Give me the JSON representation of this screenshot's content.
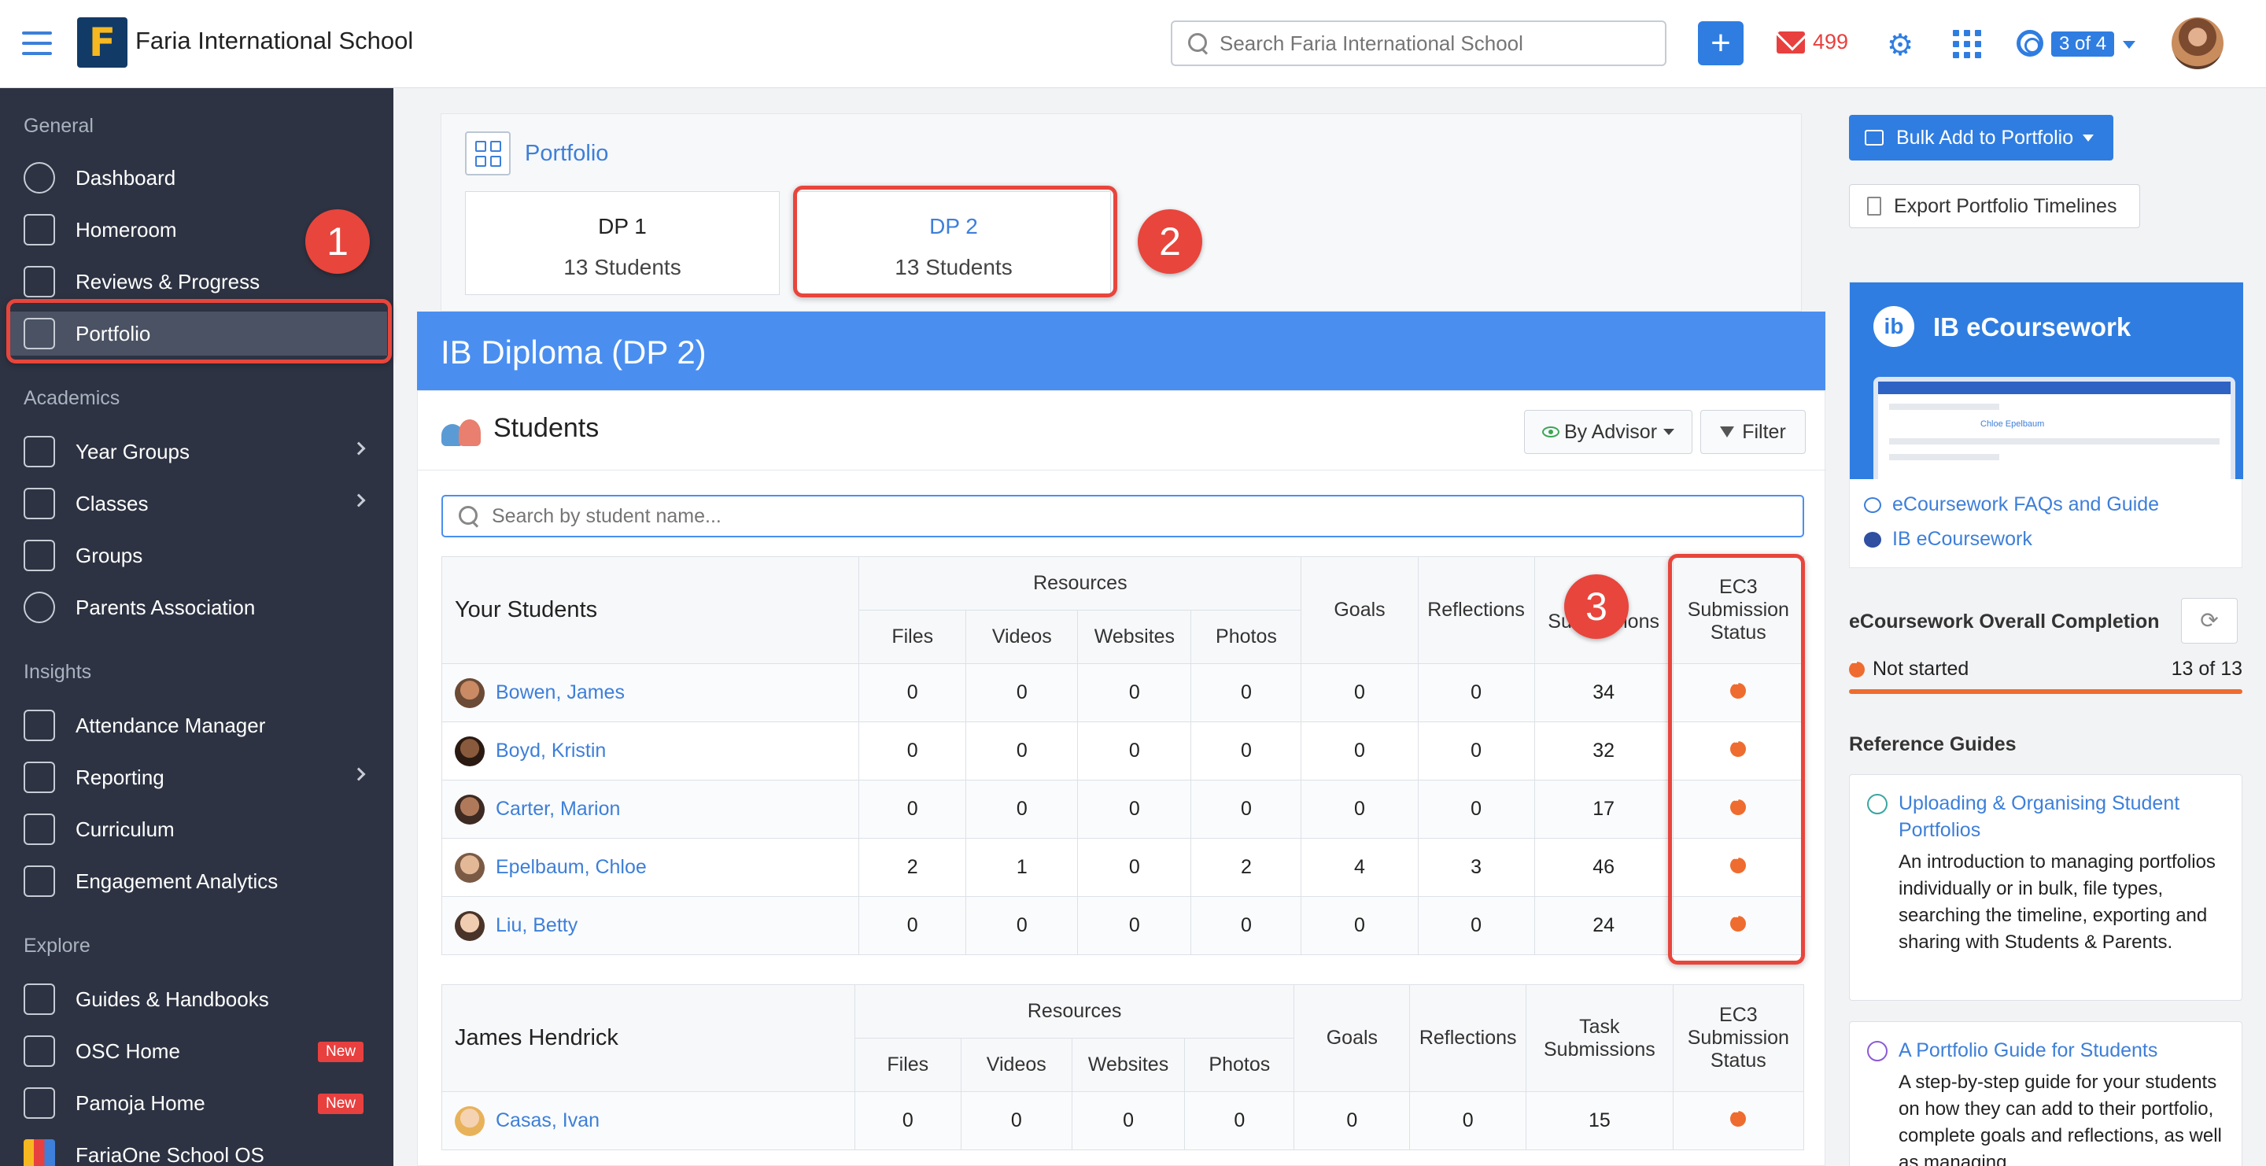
{
  "topbar": {
    "school_name": "Faria International School",
    "logo_letter": "F",
    "search_placeholder": "Search Faria International School",
    "add_label": "+",
    "mail_count": "499",
    "pager_label": "3 of 4",
    "accent": "#2f7de1"
  },
  "sidebar": {
    "sections": [
      {
        "label": "General",
        "items": [
          {
            "label": "Dashboard",
            "icon": "dashboard-icon"
          },
          {
            "label": "Homeroom",
            "icon": "homeroom-icon"
          },
          {
            "label": "Reviews & Progress",
            "icon": "chart-icon"
          },
          {
            "label": "Portfolio",
            "icon": "briefcase-icon",
            "active": true
          }
        ]
      },
      {
        "label": "Academics",
        "items": [
          {
            "label": "Year Groups",
            "icon": "year-groups-icon"
          },
          {
            "label": "Classes",
            "icon": "classes-icon"
          },
          {
            "label": "Groups",
            "icon": "cube-icon"
          },
          {
            "label": "Parents Association",
            "icon": "people-icon"
          }
        ]
      },
      {
        "label": "Insights",
        "items": [
          {
            "label": "Attendance Manager",
            "icon": "attendance-icon"
          },
          {
            "label": "Reporting",
            "icon": "reporting-icon"
          },
          {
            "label": "Curriculum",
            "icon": "map-icon"
          },
          {
            "label": "Engagement Analytics",
            "icon": "analytics-icon"
          }
        ]
      },
      {
        "label": "Explore",
        "items": [
          {
            "label": "Guides & Handbooks",
            "icon": "guides-icon"
          },
          {
            "label": "OSC Home",
            "icon": "osc-icon",
            "badge": "New"
          },
          {
            "label": "Pamoja Home",
            "icon": "pamoja-icon",
            "badge": "New"
          },
          {
            "label": "FariaOne School OS",
            "icon": "fariaone-icon"
          }
        ]
      }
    ]
  },
  "portfolio": {
    "title": "Portfolio",
    "tabs": [
      {
        "title": "DP 1",
        "subtitle": "13 Students"
      },
      {
        "title": "DP 2",
        "subtitle": "13 Students",
        "active": true
      }
    ]
  },
  "main": {
    "banner": "IB Diploma (DP 2)",
    "students_title": "Students",
    "by_advisor_label": "By Advisor",
    "filter_label": "Filter",
    "search_placeholder": "Search by student name..."
  },
  "table_headers": {
    "resources": "Resources",
    "files": "Files",
    "videos": "Videos",
    "websites": "Websites",
    "photos": "Photos",
    "goals": "Goals",
    "reflections": "Reflections",
    "task_submissions": "Task Submissions",
    "ec3_status": "EC3 Submission Status"
  },
  "groups": [
    {
      "name": "Your Students",
      "rows": [
        {
          "name": "Bowen, James",
          "files": "0",
          "videos": "0",
          "websites": "0",
          "photos": "0",
          "goals": "0",
          "reflections": "0",
          "tasks": "34"
        },
        {
          "name": "Boyd, Kristin",
          "files": "0",
          "videos": "0",
          "websites": "0",
          "photos": "0",
          "goals": "0",
          "reflections": "0",
          "tasks": "32"
        },
        {
          "name": "Carter, Marion",
          "files": "0",
          "videos": "0",
          "websites": "0",
          "photos": "0",
          "goals": "0",
          "reflections": "0",
          "tasks": "17"
        },
        {
          "name": "Epelbaum, Chloe",
          "files": "2",
          "videos": "1",
          "websites": "0",
          "photos": "2",
          "goals": "4",
          "reflections": "3",
          "tasks": "46"
        },
        {
          "name": "Liu, Betty",
          "files": "0",
          "videos": "0",
          "websites": "0",
          "photos": "0",
          "goals": "0",
          "reflections": "0",
          "tasks": "24"
        }
      ]
    },
    {
      "name": "James Hendrick",
      "rows": [
        {
          "name": "Casas, Ivan",
          "files": "0",
          "videos": "0",
          "websites": "0",
          "photos": "0",
          "goals": "0",
          "reflections": "0",
          "tasks": "15"
        }
      ]
    }
  ],
  "right": {
    "bulk_label": "Bulk Add to Portfolio",
    "export_label": "Export Portfolio Timelines",
    "ib_title": "IB eCoursework",
    "ib_logo": "ib",
    "ib_preview_name": "Chloe Epelbaum",
    "ib_faq_link": "eCoursework FAQs and Guide",
    "ib_link": "IB eCoursework",
    "completion_title": "eCoursework Overall Completion",
    "not_started": "Not started",
    "completion_count": "13 of 13",
    "ref_title": "Reference Guides",
    "refs": [
      {
        "title": "Uploading & Organising Student Portfolios",
        "desc": "An introduction to managing portfolios individually or in bulk, file types, searching the timeline, exporting and sharing with Students & Parents."
      },
      {
        "title": "A Portfolio Guide for Students",
        "desc": "A step-by-step guide for your students on how they can add to their portfolio, complete goals and reflections, as well as managing"
      }
    ]
  },
  "callouts": [
    "1",
    "2",
    "3"
  ],
  "colors": {
    "status_not_started": "#ee6c2f",
    "callout": "#e8453c",
    "sidebar_bg": "#2d3342",
    "banner": "#4a8ff0"
  }
}
